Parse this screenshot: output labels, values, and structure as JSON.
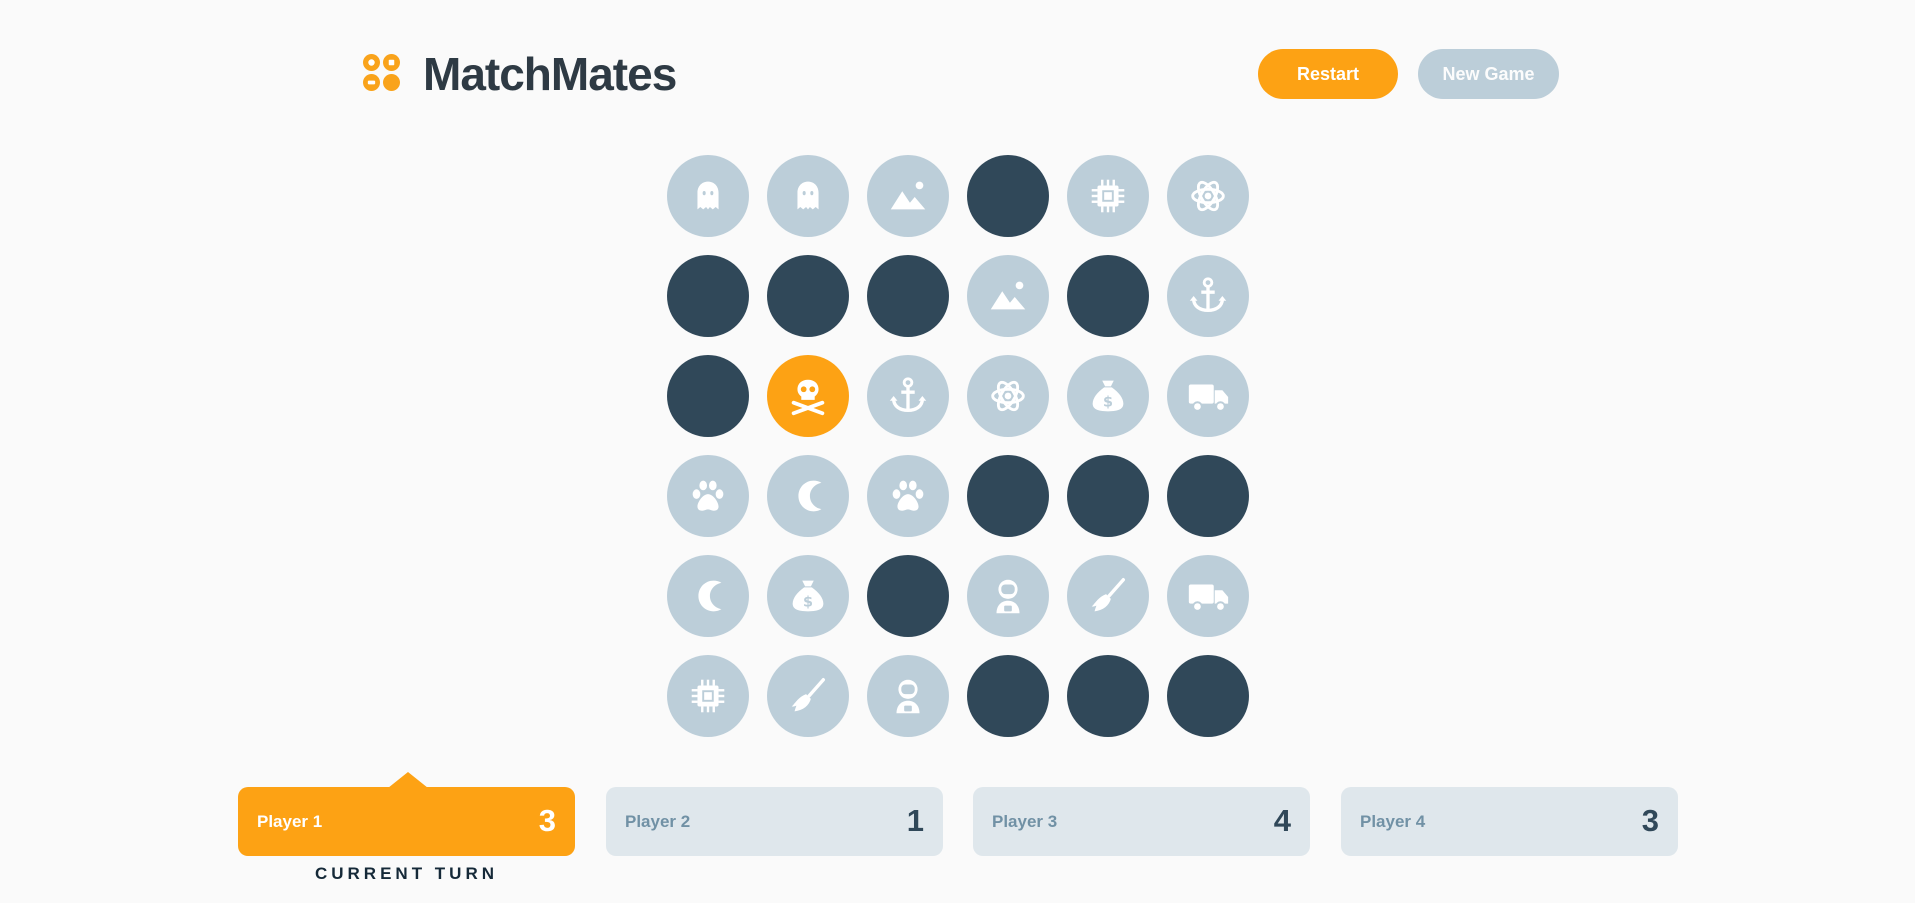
{
  "app": {
    "title": "MatchMates",
    "brand_color": "#FDA214",
    "hidden_color": "#304859",
    "revealed_color": "#BCCED9"
  },
  "header": {
    "restart_label": "Restart",
    "new_game_label": "New Game"
  },
  "board": {
    "rows": 6,
    "cols": 6,
    "cells": [
      [
        "ghost-icon",
        "ghost-icon",
        "mountain-icon",
        "hidden",
        "chip-icon",
        "atom-icon"
      ],
      [
        "hidden",
        "hidden",
        "hidden",
        "mountain-icon",
        "hidden",
        "anchor-icon"
      ],
      [
        "hidden",
        "skull-icon",
        "anchor-icon",
        "atom-icon",
        "money-bag-icon",
        "truck-icon"
      ],
      [
        "paw-icon",
        "moon-icon",
        "paw-icon",
        "hidden",
        "hidden",
        "hidden"
      ],
      [
        "moon-icon",
        "money-bag-icon",
        "hidden",
        "astronaut-icon",
        "broom-icon",
        "truck-icon"
      ],
      [
        "chip-icon",
        "broom-icon",
        "astronaut-icon",
        "hidden",
        "hidden",
        "hidden"
      ]
    ],
    "selected": {
      "row": 2,
      "col": 1
    }
  },
  "players": [
    {
      "name": "Player 1",
      "score": "3",
      "active": true
    },
    {
      "name": "Player 2",
      "score": "1",
      "active": false
    },
    {
      "name": "Player 3",
      "score": "4",
      "active": false
    },
    {
      "name": "Player 4",
      "score": "3",
      "active": false
    }
  ],
  "current_turn_label": "CURRENT TURN"
}
